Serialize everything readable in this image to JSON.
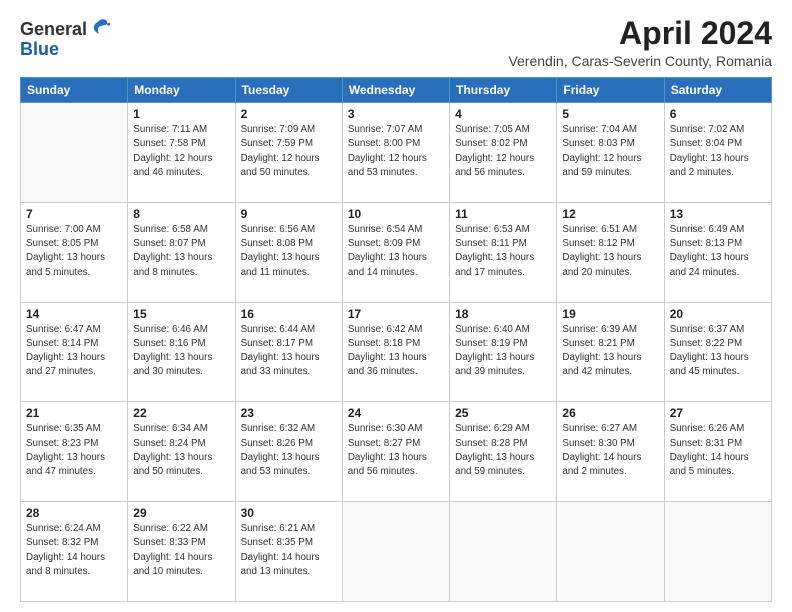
{
  "header": {
    "logo_general": "General",
    "logo_blue": "Blue",
    "month_title": "April 2024",
    "subtitle": "Verendin, Caras-Severin County, Romania"
  },
  "days_of_week": [
    "Sunday",
    "Monday",
    "Tuesday",
    "Wednesday",
    "Thursday",
    "Friday",
    "Saturday"
  ],
  "weeks": [
    [
      {
        "day": "",
        "empty": true
      },
      {
        "day": "1",
        "sunrise": "7:11 AM",
        "sunset": "7:58 PM",
        "daylight": "12 hours and 46 minutes."
      },
      {
        "day": "2",
        "sunrise": "7:09 AM",
        "sunset": "7:59 PM",
        "daylight": "12 hours and 50 minutes."
      },
      {
        "day": "3",
        "sunrise": "7:07 AM",
        "sunset": "8:00 PM",
        "daylight": "12 hours and 53 minutes."
      },
      {
        "day": "4",
        "sunrise": "7:05 AM",
        "sunset": "8:02 PM",
        "daylight": "12 hours and 56 minutes."
      },
      {
        "day": "5",
        "sunrise": "7:04 AM",
        "sunset": "8:03 PM",
        "daylight": "12 hours and 59 minutes."
      },
      {
        "day": "6",
        "sunrise": "7:02 AM",
        "sunset": "8:04 PM",
        "daylight": "13 hours and 2 minutes."
      }
    ],
    [
      {
        "day": "7",
        "sunrise": "7:00 AM",
        "sunset": "8:05 PM",
        "daylight": "13 hours and 5 minutes."
      },
      {
        "day": "8",
        "sunrise": "6:58 AM",
        "sunset": "8:07 PM",
        "daylight": "13 hours and 8 minutes."
      },
      {
        "day": "9",
        "sunrise": "6:56 AM",
        "sunset": "8:08 PM",
        "daylight": "13 hours and 11 minutes."
      },
      {
        "day": "10",
        "sunrise": "6:54 AM",
        "sunset": "8:09 PM",
        "daylight": "13 hours and 14 minutes."
      },
      {
        "day": "11",
        "sunrise": "6:53 AM",
        "sunset": "8:11 PM",
        "daylight": "13 hours and 17 minutes."
      },
      {
        "day": "12",
        "sunrise": "6:51 AM",
        "sunset": "8:12 PM",
        "daylight": "13 hours and 20 minutes."
      },
      {
        "day": "13",
        "sunrise": "6:49 AM",
        "sunset": "8:13 PM",
        "daylight": "13 hours and 24 minutes."
      }
    ],
    [
      {
        "day": "14",
        "sunrise": "6:47 AM",
        "sunset": "8:14 PM",
        "daylight": "13 hours and 27 minutes."
      },
      {
        "day": "15",
        "sunrise": "6:46 AM",
        "sunset": "8:16 PM",
        "daylight": "13 hours and 30 minutes."
      },
      {
        "day": "16",
        "sunrise": "6:44 AM",
        "sunset": "8:17 PM",
        "daylight": "13 hours and 33 minutes."
      },
      {
        "day": "17",
        "sunrise": "6:42 AM",
        "sunset": "8:18 PM",
        "daylight": "13 hours and 36 minutes."
      },
      {
        "day": "18",
        "sunrise": "6:40 AM",
        "sunset": "8:19 PM",
        "daylight": "13 hours and 39 minutes."
      },
      {
        "day": "19",
        "sunrise": "6:39 AM",
        "sunset": "8:21 PM",
        "daylight": "13 hours and 42 minutes."
      },
      {
        "day": "20",
        "sunrise": "6:37 AM",
        "sunset": "8:22 PM",
        "daylight": "13 hours and 45 minutes."
      }
    ],
    [
      {
        "day": "21",
        "sunrise": "6:35 AM",
        "sunset": "8:23 PM",
        "daylight": "13 hours and 47 minutes."
      },
      {
        "day": "22",
        "sunrise": "6:34 AM",
        "sunset": "8:24 PM",
        "daylight": "13 hours and 50 minutes."
      },
      {
        "day": "23",
        "sunrise": "6:32 AM",
        "sunset": "8:26 PM",
        "daylight": "13 hours and 53 minutes."
      },
      {
        "day": "24",
        "sunrise": "6:30 AM",
        "sunset": "8:27 PM",
        "daylight": "13 hours and 56 minutes."
      },
      {
        "day": "25",
        "sunrise": "6:29 AM",
        "sunset": "8:28 PM",
        "daylight": "13 hours and 59 minutes."
      },
      {
        "day": "26",
        "sunrise": "6:27 AM",
        "sunset": "8:30 PM",
        "daylight": "14 hours and 2 minutes."
      },
      {
        "day": "27",
        "sunrise": "6:26 AM",
        "sunset": "8:31 PM",
        "daylight": "14 hours and 5 minutes."
      }
    ],
    [
      {
        "day": "28",
        "sunrise": "6:24 AM",
        "sunset": "8:32 PM",
        "daylight": "14 hours and 8 minutes."
      },
      {
        "day": "29",
        "sunrise": "6:22 AM",
        "sunset": "8:33 PM",
        "daylight": "14 hours and 10 minutes."
      },
      {
        "day": "30",
        "sunrise": "6:21 AM",
        "sunset": "8:35 PM",
        "daylight": "14 hours and 13 minutes."
      },
      {
        "day": "",
        "empty": true
      },
      {
        "day": "",
        "empty": true
      },
      {
        "day": "",
        "empty": true
      },
      {
        "day": "",
        "empty": true
      }
    ]
  ]
}
